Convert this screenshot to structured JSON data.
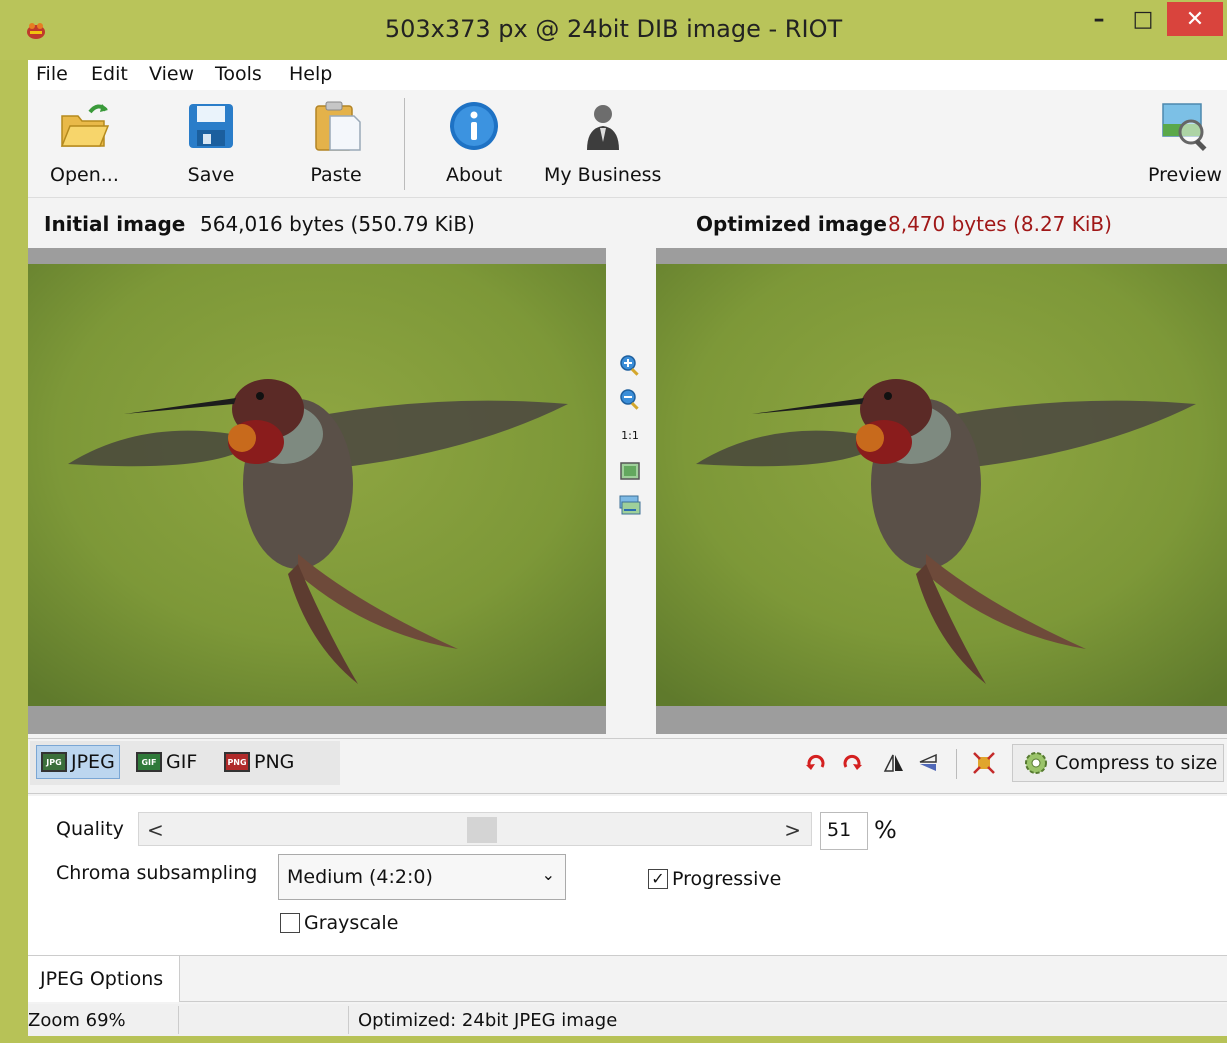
{
  "window": {
    "title": "503x373 px @ 24bit  DIB image - RIOT",
    "minimize_label": "–",
    "maximize_label": "□",
    "close_label": "✕",
    "accent": "#b9c45a"
  },
  "menu": {
    "items": [
      "File",
      "Edit",
      "View",
      "Tools",
      "Help"
    ]
  },
  "toolbar": {
    "open_label": "Open...",
    "save_label": "Save",
    "paste_label": "Paste",
    "about_label": "About",
    "business_label": "My Business",
    "preview_label": "Preview"
  },
  "images": {
    "initial_label": "Initial image",
    "initial_size": "564,016 bytes (550.79 KiB)",
    "optimized_label": "Optimized image",
    "optimized_size": "8,470 bytes (8.27 KiB)",
    "optimized_size_color": "#a01818"
  },
  "zoom_controls": {
    "actual_size_label": "1:1"
  },
  "formats": {
    "jpeg_label": "JPEG",
    "gif_label": "GIF",
    "png_label": "PNG",
    "selected": "JPEG"
  },
  "image_tools": {
    "compress_label": "Compress to size"
  },
  "jpeg_options": {
    "quality_label": "Quality",
    "quality_value": "51",
    "quality_min": 0,
    "quality_max": 100,
    "percent_sign": "%",
    "slider_left_arrow": "<",
    "slider_right_arrow": ">",
    "chroma_label": "Chroma subsampling",
    "chroma_value": "Medium (4:2:0)",
    "progressive_label": "Progressive",
    "progressive_checked": true,
    "grayscale_label": "Grayscale",
    "grayscale_checked": false
  },
  "tabs": {
    "active": "JPEG Options"
  },
  "status": {
    "zoom": "Zoom 69%",
    "info": "Optimized: 24bit JPEG image"
  }
}
